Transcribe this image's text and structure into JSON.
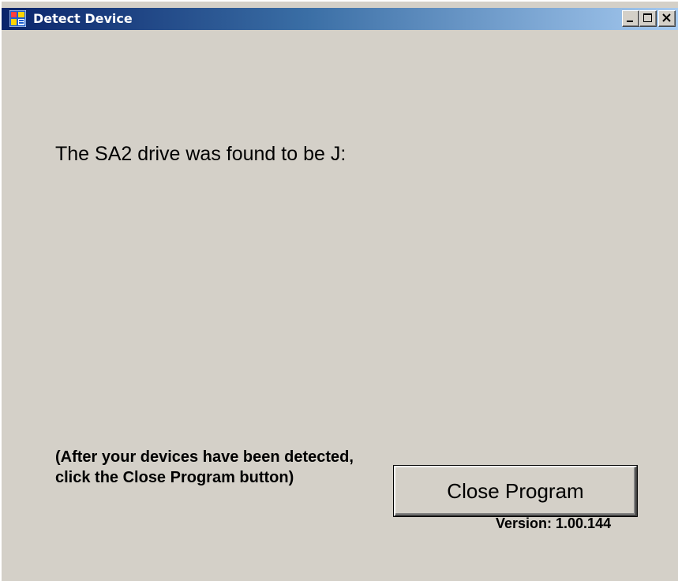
{
  "window": {
    "title": "Detect Device"
  },
  "main": {
    "found_message": "The SA2 drive was found to be J:",
    "hint": "(After your devices have been detected, click the Close Program button)",
    "close_button_label": "Close Program",
    "version": "Version: 1.00.144"
  },
  "icons": [
    "app-icon",
    "minimize-icon",
    "maximize-icon",
    "close-icon"
  ]
}
